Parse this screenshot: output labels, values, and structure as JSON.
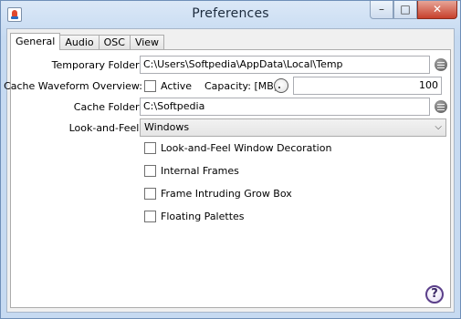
{
  "window": {
    "title": "Preferences",
    "minimize": "–",
    "maximize": "□",
    "close": "✕"
  },
  "tabs": [
    {
      "label": "General"
    },
    {
      "label": "Audio"
    },
    {
      "label": "OSC"
    },
    {
      "label": "View"
    }
  ],
  "general": {
    "temp_folder_label": "Temporary Folder:",
    "temp_folder_value": "C:\\Users\\Softpedia\\AppData\\Local\\Temp",
    "cache_overview_label": "Cache Waveform Overview:",
    "active_label": "Active",
    "capacity_label": "Capacity: [MB]",
    "capacity_value": "100",
    "cache_folder_label": "Cache Folder:",
    "cache_folder_value": "C:\\Softpedia",
    "laf_label": "Look-and-Feel:",
    "laf_value": "Windows",
    "checkboxes": [
      {
        "label": "Look-and-Feel Window Decoration",
        "checked": false
      },
      {
        "label": "Internal Frames",
        "checked": false
      },
      {
        "label": "Frame Intruding Grow Box",
        "checked": false
      },
      {
        "label": "Floating Palettes",
        "checked": false
      }
    ]
  },
  "help_label": "?"
}
